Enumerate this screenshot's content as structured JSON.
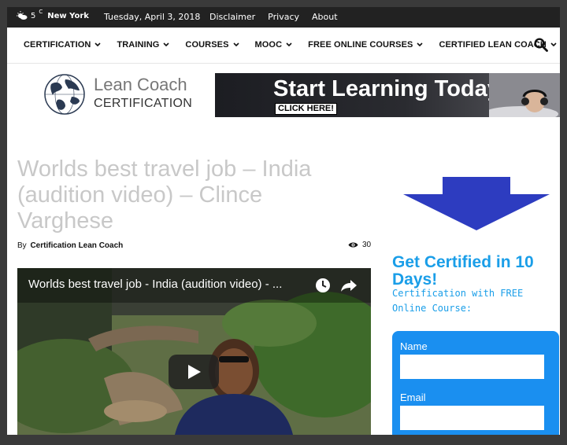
{
  "topbar": {
    "temp": "5",
    "unit": "C",
    "city": "New York",
    "date": "Tuesday, April 3, 2018",
    "links": [
      "Disclaimer",
      "Privacy",
      "About"
    ]
  },
  "nav": {
    "items": [
      "CERTIFICATION",
      "TRAINING",
      "COURSES",
      "MOOC",
      "FREE ONLINE COURSES",
      "CERTIFIED LEAN COACH"
    ]
  },
  "logo": {
    "line1": "Lean Coach",
    "line2": "CERTIFICATION"
  },
  "banner": {
    "headline": "Start Learning Today!",
    "cta": "CLICK HERE!"
  },
  "article": {
    "title": "Worlds best travel job – India (audition video) – Clince Varghese",
    "by_label": "By",
    "author": "Certification Lean Coach",
    "views": "30"
  },
  "video": {
    "title": "Worlds best travel job - India (audition video) - ..."
  },
  "sidebar": {
    "heading": "Get Certified in 10 Days!",
    "subtext": "Certification with FREE Online Course:",
    "form": {
      "name_label": "Name",
      "email_label": "Email"
    }
  },
  "colors": {
    "accent": "#1a9ee8",
    "form_bg": "#1a8ff0",
    "arrow": "#2d3cc0",
    "topbar_bg": "#222222"
  }
}
